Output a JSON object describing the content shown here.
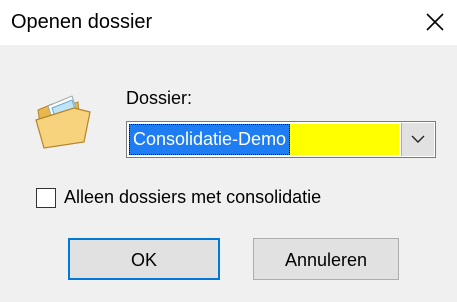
{
  "window": {
    "title": "Openen dossier",
    "close_icon": "close-icon"
  },
  "form": {
    "folder_icon": "open-folder-icon",
    "dossier_label": "Dossier:",
    "dossier_value": "Consolidatie-Demo",
    "dropdown_icon": "chevron-down-icon",
    "only_consolidation_label": "Alleen dossiers met consolidatie",
    "only_consolidation_checked": false
  },
  "buttons": {
    "ok_label": "OK",
    "cancel_label": "Annuleren"
  },
  "colors": {
    "selection": "#1e7df2",
    "highlight": "#ffff00",
    "default_button_border": "#0078d7"
  }
}
